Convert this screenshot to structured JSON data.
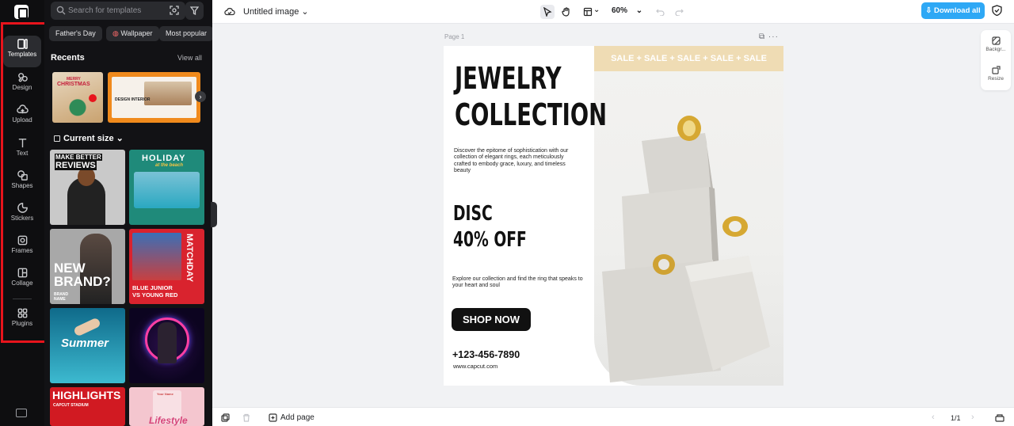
{
  "sidebar": {
    "items": [
      {
        "label": "Templates",
        "icon": "templates-icon",
        "active": true
      },
      {
        "label": "Design",
        "icon": "design-icon"
      },
      {
        "label": "Upload",
        "icon": "upload-cloud-icon"
      },
      {
        "label": "Text",
        "icon": "text-icon"
      },
      {
        "label": "Shapes",
        "icon": "shapes-icon"
      },
      {
        "label": "Stickers",
        "icon": "stickers-icon"
      },
      {
        "label": "Frames",
        "icon": "frames-icon"
      },
      {
        "label": "Collage",
        "icon": "collage-icon"
      },
      {
        "label": "Plugins",
        "icon": "plugins-icon"
      }
    ],
    "highlight_color": "#e8141c"
  },
  "panel": {
    "search_placeholder": "Search for templates",
    "chips": [
      "Father's Day",
      "Wallpaper",
      "Most popular"
    ],
    "recents_title": "Recents",
    "view_all": "View all",
    "recents": [
      {
        "t1": "MERRY",
        "t2": "CHRISTMAS"
      },
      {
        "t1": "DESIGN INTERIOR"
      }
    ],
    "current_size_title": "Current size",
    "templates": [
      {
        "t1": "MAKE BETTER",
        "t2": "REVIEWS"
      },
      {
        "t1": "HOLIDAY",
        "t2": "at the beach"
      },
      {
        "t1": "NEW",
        "t2": "BRAND?",
        "t3": "BRAND NAME"
      },
      {
        "t1": "MATCHDAY",
        "t2": "BLUE JUNIOR",
        "t3": "VS YOUNG RED"
      },
      {
        "t1": "Summer"
      },
      {
        "t1": ""
      },
      {
        "t1": "HIGHLIGHTS",
        "t2": "CAPCUT STADIUM"
      },
      {
        "t1": "Lifestyle",
        "t2": "Your Name"
      }
    ]
  },
  "topbar": {
    "doc_title": "Untitled image",
    "zoom": "60%",
    "download_label": "Download all",
    "accent": "#2ea8f5"
  },
  "canvas": {
    "page_label": "Page 1",
    "design": {
      "sale_band": "SALE + SALE + SALE + SALE + SALE",
      "headline_1": "JEWELRY",
      "headline_2": "COLLECTION",
      "description": "Discover the epitome of sophistication with our collection of elegant rings, each meticulously crafted to embody grace, luxury, and timeless beauty",
      "disc_1": "DISC",
      "disc_2": "40% OFF",
      "explore": "Explore our collection and find the ring that speaks to your heart and soul",
      "cta": "SHOP NOW",
      "phone": "+123-456-7890",
      "website": "www.capcut.com"
    }
  },
  "right_panel": {
    "background_label": "Backgr...",
    "resize_label": "Resize"
  },
  "bottombar": {
    "add_page": "Add page",
    "pager": "1/1"
  }
}
